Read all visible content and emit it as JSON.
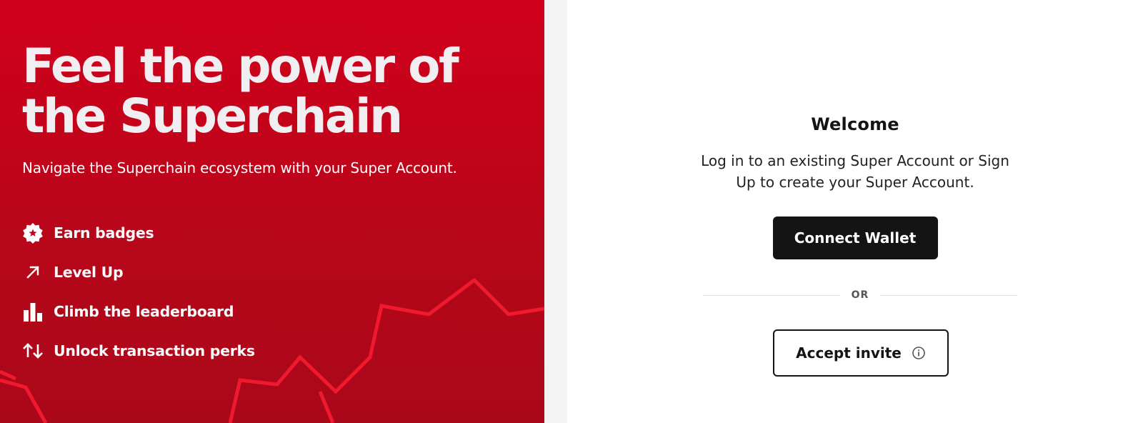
{
  "hero": {
    "title": "Feel the power of the Superchain",
    "subtitle": "Navigate the Superchain ecosystem with your Super Account.",
    "features": [
      {
        "icon": "badge-star-icon",
        "label": "Earn badges"
      },
      {
        "icon": "arrow-up-right-icon",
        "label": "Level Up"
      },
      {
        "icon": "bar-chart-icon",
        "label": "Climb the leaderboard"
      },
      {
        "icon": "swap-arrows-icon",
        "label": "Unlock transaction perks"
      }
    ],
    "colors": {
      "background": "#c1001b",
      "accent_lines": "#f0192e",
      "text": "#f4f4f4"
    }
  },
  "login": {
    "title": "Welcome",
    "description": "Log in to an existing Super Account or Sign Up to create your Super Account.",
    "connect_label": "Connect Wallet",
    "divider_label": "OR",
    "invite_label": "Accept invite",
    "invite_icon": "info-icon"
  }
}
